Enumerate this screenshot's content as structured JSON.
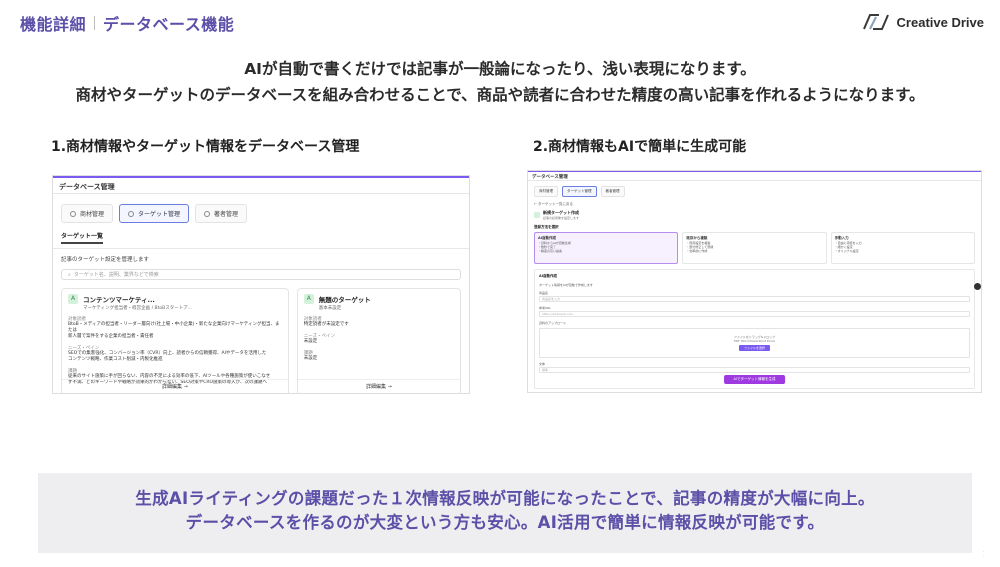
{
  "header": {
    "category": "機能詳細",
    "title": "データベース機能"
  },
  "logo": {
    "text": "Creative Drive"
  },
  "lead": {
    "line1": "AIが自動で書くだけでは記事が一般論になったり、浅い表現になります。",
    "line2": "商材やターゲットのデータベースを組み合わせることで、商品や読者に合わせた精度の高い記事を作れるようになります。"
  },
  "section1": {
    "title": "1.商材情報やターゲット情報をデータベース管理",
    "screenshot": {
      "app_title": "データベース管理",
      "tabs": [
        {
          "label": "商材管理"
        },
        {
          "label": "ターゲット管理",
          "active": true
        },
        {
          "label": "著者管理"
        }
      ],
      "subtab": "ターゲット一覧",
      "description": "記事のターゲット設定を管理します",
      "search_placeholder": "ターゲット名、説明、業界などで検索",
      "cards": [
        {
          "name": "コンテンツマーケティ...",
          "sub": "マーケティング担当者・経営企画 / BtoBスタートア...",
          "label1": "対象読者",
          "text1": "BtoB・メディアの担当者・リーダー層向け(社上場・中小企業)・新たな企業向けマーケティング担当、または",
          "text1b": "新人層で案件をする企業の担当者・責任者",
          "label2": "ニーズ・ペイン",
          "text2": "SEOでの集客強化、コンバージョン率（CVR）向上、読者からの信頼獲得、AIやデータを活用した",
          "text2b": "コンテンツ戦略、作業コスト削減・内製化推進",
          "label3": "課題",
          "text3": "従来のサイト施策に手が回らない、内容の不足による効率の低下、AIツールや各種施策が使いこなせ",
          "text3b": "ず不満、どのキーワードや戦略が効果的かわからない、SEO対策やCRO施策の導入が、次の課題へ",
          "more": "詳細編集"
        },
        {
          "name": "無題のターゲット",
          "sub": "基本未設定",
          "label1": "対象読者",
          "text1": "特定読者が未設定です",
          "label2": "ニーズ・ペイン",
          "text2": "未設定",
          "label3": "課題",
          "text3": "未設定",
          "more": "詳細編集"
        }
      ]
    }
  },
  "section2": {
    "title": "2.商材情報もAIで簡単に生成可能",
    "screenshot": {
      "app_title": "データベース管理",
      "tabs": [
        {
          "label": "商材管理"
        },
        {
          "label": "ターゲット管理",
          "active": true
        },
        {
          "label": "著者管理"
        }
      ],
      "back_link": "← ターゲット一覧に戻る",
      "new_target": {
        "name": "新規ターゲット作成",
        "sub": "記事の読者像を設定します"
      },
      "select_label": "登録方法を選択",
      "options": [
        {
          "title": "AI自動作成",
          "active": true,
          "lines": [
            "・資料からAIが自動生成",
            "・数秒で完了",
            "・精度の高い提案"
          ]
        },
        {
          "title": "既存から複製",
          "active": false,
          "lines": [
            "・既存設定を複製",
            "・部分修正して登録",
            "・効率的に作成"
          ]
        },
        {
          "title": "手動入力",
          "active": false,
          "lines": [
            "・自由に項目を入力",
            "・細かく設定",
            "・オリジナル設定"
          ]
        }
      ],
      "form": {
        "title": "AI自動作成",
        "sub": "ターゲット情報をAIが自動で作成します",
        "field1_label": "商品名",
        "field1_placeholder": "商品名を入力",
        "field2_label": "参考URL",
        "field2_placeholder": "https://example.com",
        "field3_label": "資料のアップロード",
        "drop_text": "ファイルをドラッグ&ドロップ",
        "drop_sub": "PDF Word PowerPoint Excel",
        "upload_label": "ファイルを選択",
        "field4_label": "文体",
        "field4_value": "標準",
        "generate_label": "AIでターゲット情報を生成"
      }
    }
  },
  "banner": {
    "line1": "生成AIライティングの課題だった１次情報反映が可能になったことで、記事の精度が大幅に向上。",
    "line2": "データベースを作るのが大変という方も安心。AI活用で簡単に情報反映が可能です。"
  },
  "colors": {
    "accent_purple": "#5b4fa8",
    "ui_purple": "#7a5af0",
    "button_purple": "#9f3ae0"
  }
}
